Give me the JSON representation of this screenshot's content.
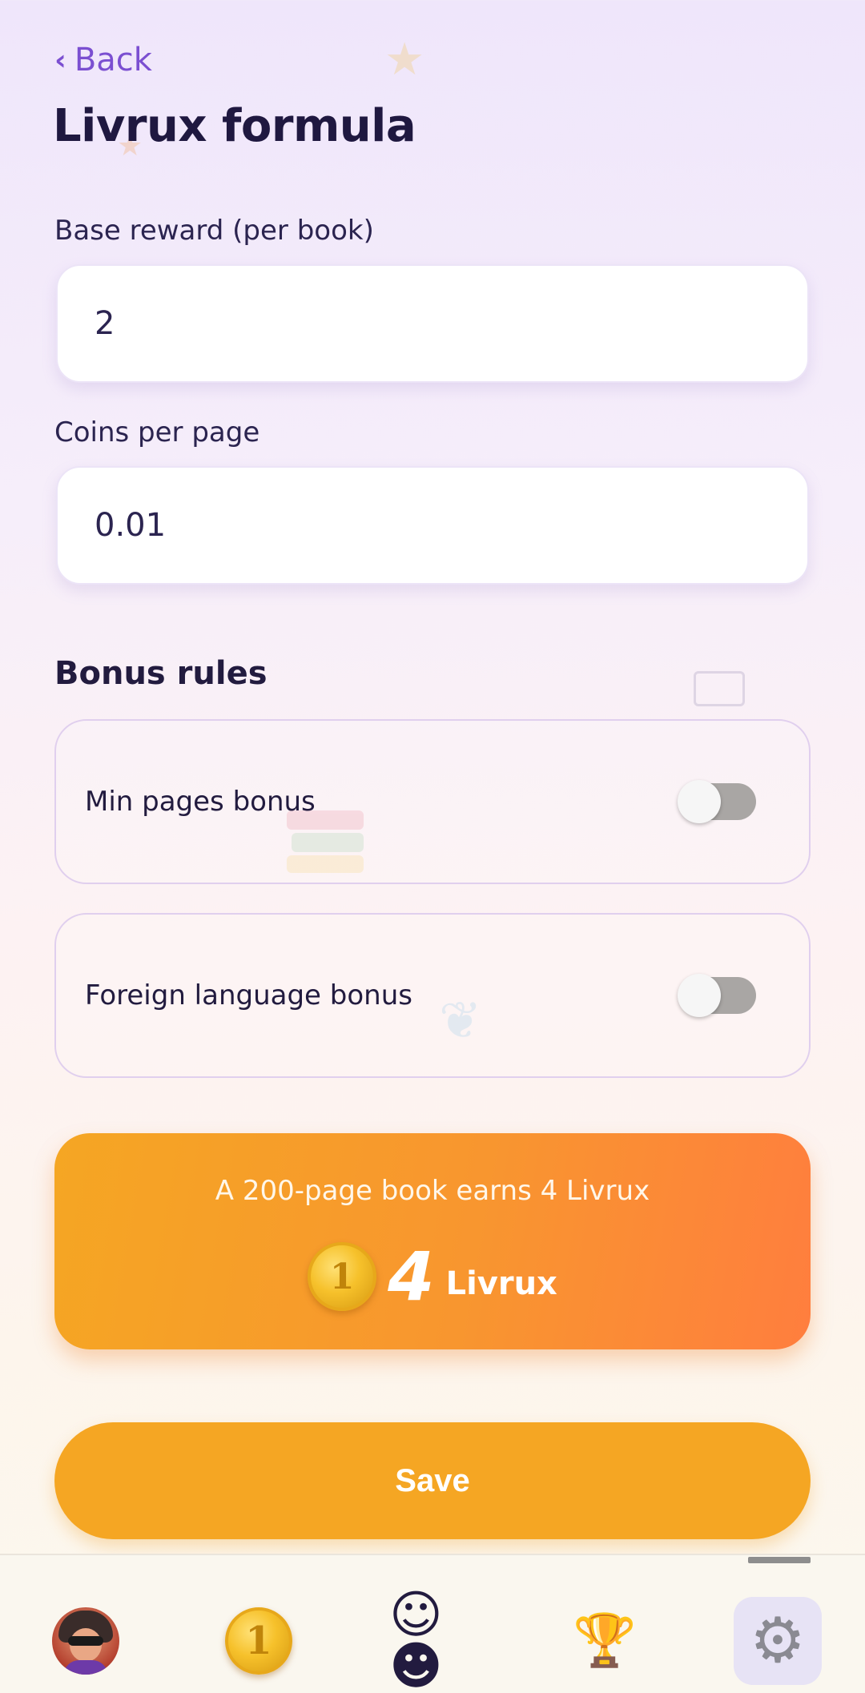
{
  "header": {
    "back_label": "Back",
    "title": "Livrux formula"
  },
  "fields": {
    "base_reward": {
      "label": "Base reward (per book)",
      "value": "2"
    },
    "coins_per_page": {
      "label": "Coins per page",
      "value": "0.01"
    }
  },
  "bonus": {
    "title": "Bonus rules",
    "rules": [
      {
        "label": "Min pages bonus",
        "enabled": false
      },
      {
        "label": "Foreign language bonus",
        "enabled": false
      }
    ]
  },
  "preview": {
    "description": "A 200-page book earns 4 Livrux",
    "coin_symbol": "1",
    "amount": "4",
    "unit": "Livrux"
  },
  "actions": {
    "save_label": "Save"
  },
  "bottom_nav": {
    "coin_symbol": "1",
    "items": [
      {
        "icon": "avatar-icon"
      },
      {
        "icon": "coin-icon"
      },
      {
        "icon": "friends-icon"
      },
      {
        "icon": "trophy-icon"
      },
      {
        "icon": "gear-icon",
        "active": true
      }
    ]
  },
  "colors": {
    "accent_purple": "#7b4fd1",
    "orange": "#f5a623",
    "orange_end": "#ff7e3e"
  }
}
